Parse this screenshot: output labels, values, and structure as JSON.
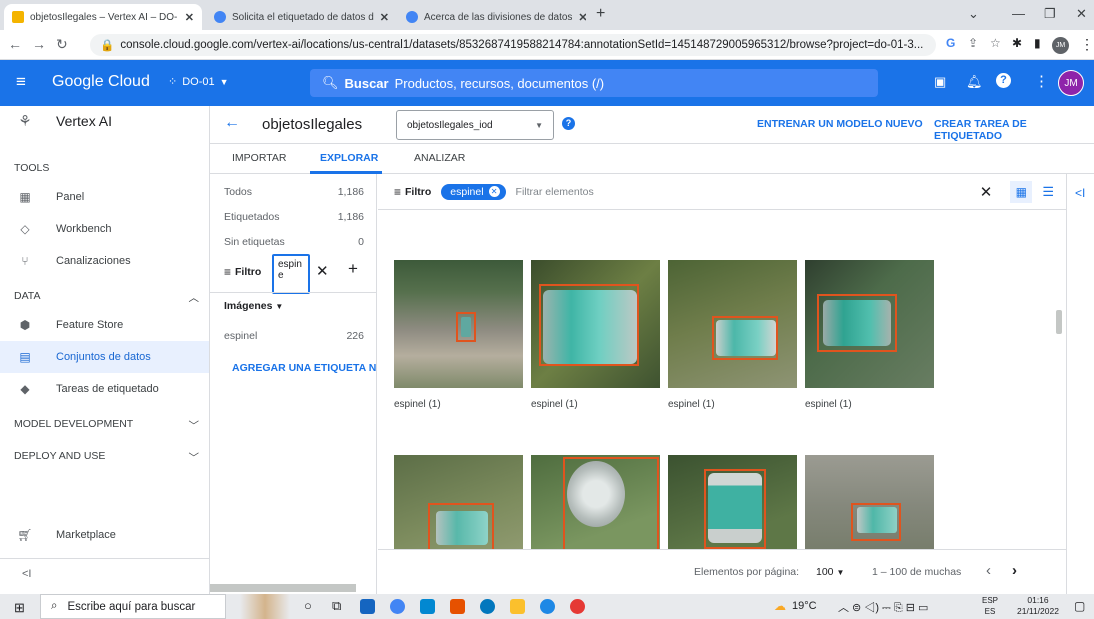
{
  "browser": {
    "tabs": [
      {
        "title": "objetosIlegales – Vertex AI – DO-"
      },
      {
        "title": "Solicita el etiquetado de datos d"
      },
      {
        "title": "Acerca de las divisiones de datos"
      }
    ],
    "url": "console.cloud.google.com/vertex-ai/locations/us-central1/datasets/8532687419588214784:annotationSetId=14514872900596531​2/browse?project=do-01-3...",
    "profile": "JM"
  },
  "header": {
    "brand": "Google Cloud",
    "project": "DO-01",
    "search_label": "Buscar",
    "search_placeholder": "Productos, recursos, documentos (/)",
    "avatar": "JM"
  },
  "sidebar": {
    "product": "Vertex AI",
    "sections": [
      {
        "label": "TOOLS"
      },
      {
        "label": "DATA"
      },
      {
        "label": "MODEL DEVELOPMENT"
      },
      {
        "label": "DEPLOY AND USE"
      }
    ],
    "items": [
      {
        "label": "Panel",
        "icon": "dashboard-icon"
      },
      {
        "label": "Workbench",
        "icon": "workbench-icon"
      },
      {
        "label": "Canalizaciones",
        "icon": "pipelines-icon"
      },
      {
        "label": "Feature Store",
        "icon": "feature-store-icon"
      },
      {
        "label": "Conjuntos de datos",
        "icon": "datasets-icon"
      },
      {
        "label": "Tareas de etiquetado",
        "icon": "labeling-icon"
      },
      {
        "label": "Marketplace",
        "icon": "marketplace-icon"
      }
    ],
    "collapse": "<I"
  },
  "main": {
    "title": "objetosIlegales",
    "dataset_select": "objetosIlegales_iod",
    "train_button": "ENTRENAR UN MODELO NUEVO",
    "create_task_button": "CREAR TAREA DE ETIQUETADO",
    "tabs": [
      "IMPORTAR",
      "EXPLORAR",
      "ANALIZAR"
    ],
    "counts": [
      {
        "label": "Todos",
        "value": "1,186"
      },
      {
        "label": "Etiquetados",
        "value": "1,186"
      },
      {
        "label": "Sin etiquetas",
        "value": "0"
      }
    ],
    "filter_label": "Filtro",
    "filter_input": "espin\ne",
    "images_label": "Imágenes",
    "label_row": {
      "label": "espinel",
      "value": "226"
    },
    "add_label": "AGREGAR UNA ETIQUETA NUE",
    "filter_chip": "espinel",
    "filter_placeholder": "Filtrar elementos",
    "captions": [
      "espinel (1)",
      "espinel (1)",
      "espinel (1)",
      "espinel (1)"
    ],
    "pager": {
      "per_page_label": "Elementos por página:",
      "per_page": "100",
      "range": "1 – 100 de muchas"
    }
  },
  "taskbar": {
    "search": "Escribe aquí para buscar",
    "weather": "19°C",
    "lang": "ESP",
    "lang2": "ES",
    "time": "01:16",
    "date": "21/11/2022"
  },
  "colors": {
    "accent": "#1a73e8",
    "box": "#e0541e"
  }
}
